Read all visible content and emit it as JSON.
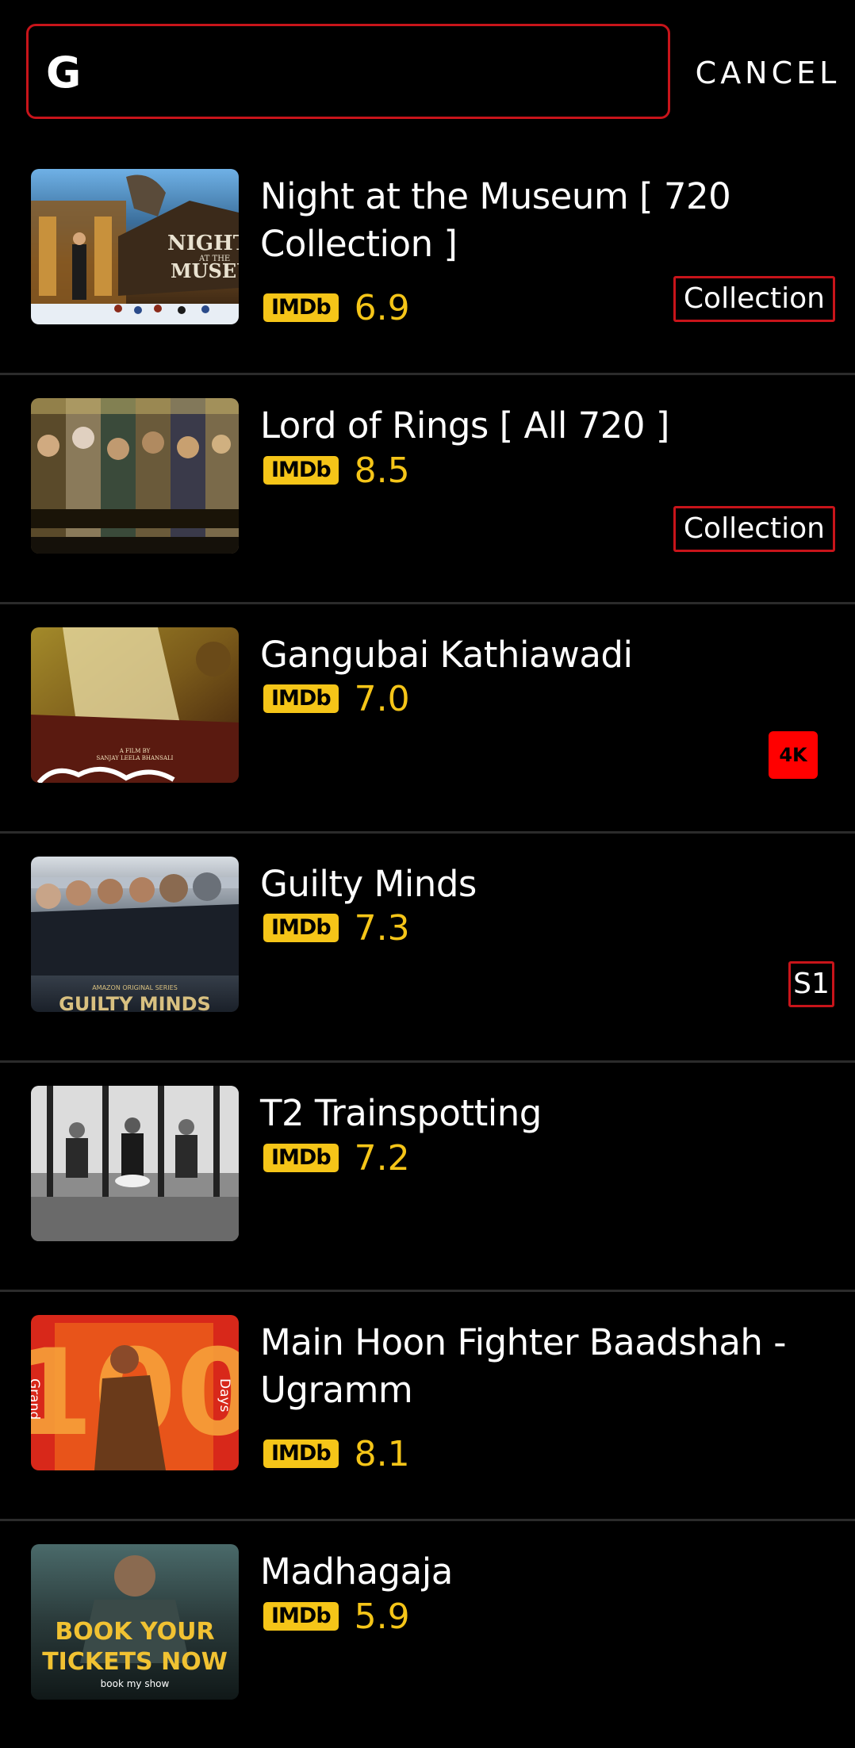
{
  "search": {
    "query": "G",
    "cancel_label": "CANCEL"
  },
  "results": [
    {
      "title": "Night at the Museum [ 720 Collection ]",
      "rating_source": "IMDb",
      "rating": "6.9",
      "tag": "Collection",
      "poster_text": [
        "NIGHT",
        "AT THE",
        "MUSEUM"
      ]
    },
    {
      "title": "Lord of Rings [ All 720 ]",
      "rating_source": "IMDb",
      "rating": "8.5",
      "tag": "Collection"
    },
    {
      "title": "Gangubai Kathiawadi",
      "rating_source": "IMDb",
      "rating": "7.0",
      "tag": "4K",
      "poster_text": [
        "A FILM BY",
        "SANJAY LEELA BHANSALI"
      ]
    },
    {
      "title": "Guilty Minds",
      "rating_source": "IMDb",
      "rating": "7.3",
      "tag": "S1",
      "poster_text": [
        "AMAZON ORIGINAL SERIES",
        "GUILTY MINDS"
      ]
    },
    {
      "title": "T2 Trainspotting",
      "rating_source": "IMDb",
      "rating": "7.2"
    },
    {
      "title": "Main Hoon Fighter Baadshah - Ugramm",
      "rating_source": "IMDb",
      "rating": "8.1",
      "poster_text": [
        "Grand",
        "Days"
      ]
    },
    {
      "title": "Madhagaja",
      "rating_source": "IMDb",
      "rating": "5.9",
      "poster_text": [
        "BOOK YOUR",
        "TICKETS NOW",
        "book my show"
      ]
    }
  ],
  "colors": {
    "background": "#000000",
    "accent_red": "#c8141a",
    "badge_4k": "#ff0000",
    "imdb_yellow": "#f5c518",
    "divider": "#2b2b2b"
  }
}
